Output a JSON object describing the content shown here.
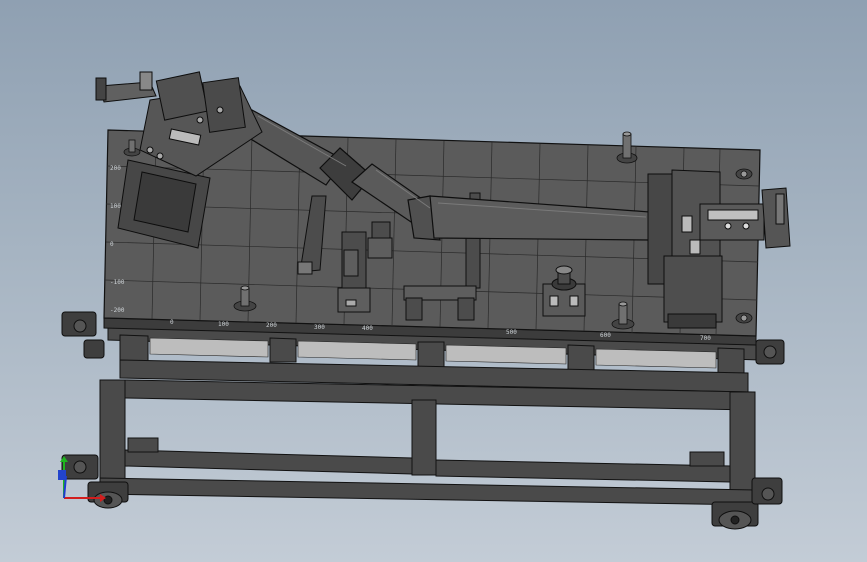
{
  "app": {
    "view_type": "cad-3d-model-view",
    "background_top": "#8fa0b2",
    "background_bottom": "#c3ccd6",
    "model_color": "#4d4d4d",
    "edge_color": "#111111"
  },
  "grid_labels": {
    "left": [
      "200",
      "100",
      "0",
      "-100",
      "-200"
    ],
    "front": [
      "0",
      "100",
      "200",
      "300",
      "400",
      "500",
      "600",
      "700"
    ]
  },
  "triad": {
    "x_axis_color": "#d21e1e",
    "y_axis_color": "#1eb41e",
    "z_axis_color": "#1e3cd2",
    "icon": "coordinate-triad-icon"
  }
}
